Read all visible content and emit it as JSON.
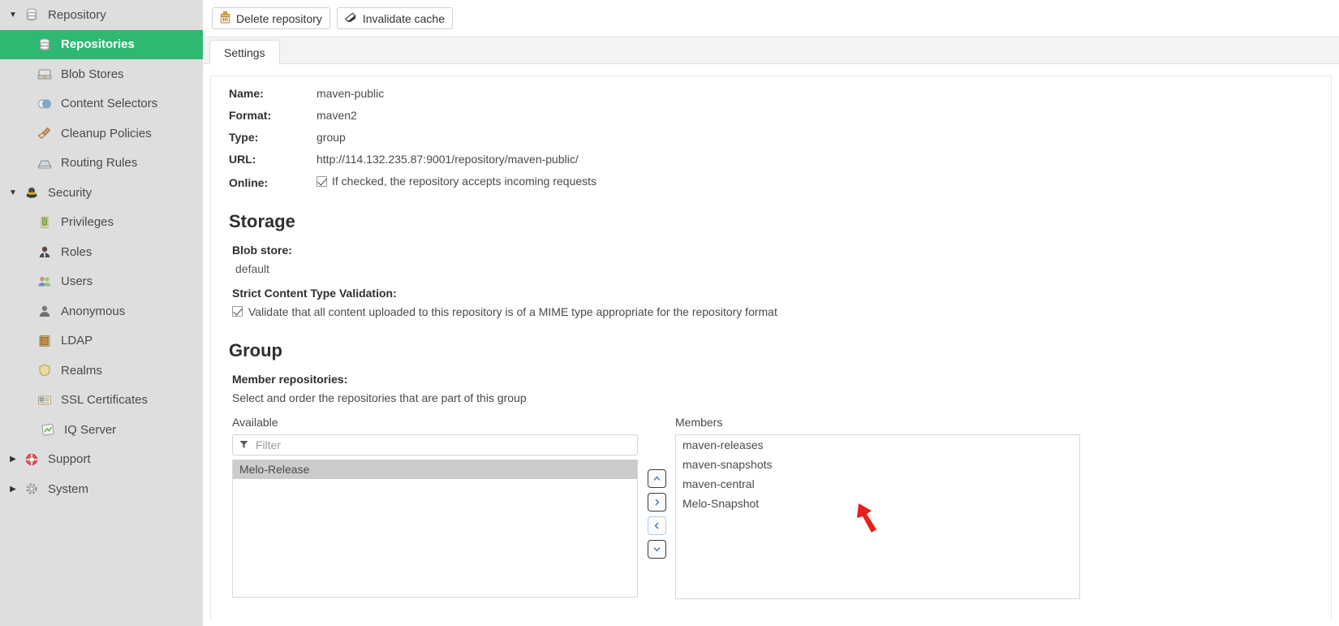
{
  "sidebar": {
    "items": [
      {
        "label": "Repository",
        "icon": "database-icon",
        "level": 0,
        "caret": "down",
        "selected": false
      },
      {
        "label": "Repositories",
        "icon": "database-icon",
        "level": 1,
        "caret": "none",
        "selected": true
      },
      {
        "label": "Blob Stores",
        "icon": "blob-store-icon",
        "level": 1,
        "caret": "none",
        "selected": false
      },
      {
        "label": "Content Selectors",
        "icon": "content-selector-icon",
        "level": 1,
        "caret": "none",
        "selected": false
      },
      {
        "label": "Cleanup Policies",
        "icon": "broom-icon",
        "level": 1,
        "caret": "none",
        "selected": false
      },
      {
        "label": "Routing Rules",
        "icon": "routing-rules-icon",
        "level": 1,
        "caret": "none",
        "selected": false
      },
      {
        "label": "Security",
        "icon": "security-icon",
        "level": 0,
        "caret": "down",
        "selected": false
      },
      {
        "label": "Privileges",
        "icon": "privileges-icon",
        "level": 1,
        "caret": "none",
        "selected": false
      },
      {
        "label": "Roles",
        "icon": "roles-icon",
        "level": 1,
        "caret": "none",
        "selected": false
      },
      {
        "label": "Users",
        "icon": "users-icon",
        "level": 1,
        "caret": "none",
        "selected": false
      },
      {
        "label": "Anonymous",
        "icon": "anonymous-icon",
        "level": 1,
        "caret": "none",
        "selected": false
      },
      {
        "label": "LDAP",
        "icon": "ldap-icon",
        "level": 1,
        "caret": "none",
        "selected": false
      },
      {
        "label": "Realms",
        "icon": "realms-shield-icon",
        "level": 1,
        "caret": "none",
        "selected": false
      },
      {
        "label": "SSL Certificates",
        "icon": "ssl-certificate-icon",
        "level": 1,
        "caret": "none",
        "selected": false
      },
      {
        "label": "IQ Server",
        "icon": "iq-server-icon",
        "level": 0,
        "caret": "none",
        "selected": false,
        "indent": true
      },
      {
        "label": "Support",
        "icon": "support-icon",
        "level": 0,
        "caret": "right",
        "selected": false
      },
      {
        "label": "System",
        "icon": "system-gear-icon",
        "level": 0,
        "caret": "right",
        "selected": false
      }
    ]
  },
  "toolbar": {
    "delete_label": "Delete repository",
    "invalidate_label": "Invalidate cache"
  },
  "tabs": [
    {
      "label": "Settings",
      "active": true
    }
  ],
  "repository": {
    "fields": [
      {
        "label": "Name:",
        "value": "maven-public"
      },
      {
        "label": "Format:",
        "value": "maven2"
      },
      {
        "label": "Type:",
        "value": "group"
      },
      {
        "label": "URL:",
        "value": "http://114.132.235.87:9001/repository/maven-public/"
      }
    ],
    "online_label": "Online:",
    "online_text": "If checked, the repository accepts incoming requests",
    "online_checked": true
  },
  "storage": {
    "heading": "Storage",
    "blob_store_label": "Blob store:",
    "blob_store_value": "default",
    "strict_label": "Strict Content Type Validation:",
    "strict_text": "Validate that all content uploaded to this repository is of a MIME type appropriate for the repository format",
    "strict_checked": true
  },
  "group": {
    "heading": "Group",
    "member_repos_label": "Member repositories:",
    "member_repos_hint": "Select and order the repositories that are part of this group",
    "available_label": "Available",
    "members_label": "Members",
    "filter_placeholder": "Filter",
    "filter_value": "",
    "available_items": [
      {
        "label": "Melo-Release",
        "selected": true
      }
    ],
    "member_items": [
      {
        "label": "maven-releases",
        "selected": false
      },
      {
        "label": "maven-snapshots",
        "selected": false
      },
      {
        "label": "maven-central",
        "selected": false
      },
      {
        "label": "Melo-Snapshot",
        "selected": false
      }
    ],
    "buttons": {
      "move_up": "⌃",
      "move_right": "›",
      "move_left": "‹",
      "move_down": "⌄"
    }
  },
  "colors": {
    "sidebar_bg": "#dedede",
    "selected_green": "#2eb872",
    "annotation_red": "#e8201c",
    "list_selected": "#cccccc"
  }
}
